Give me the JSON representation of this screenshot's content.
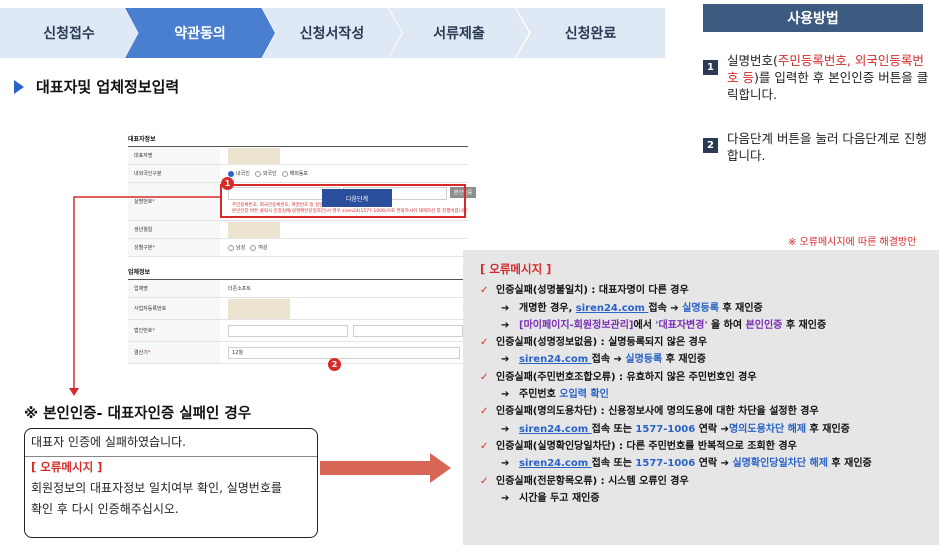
{
  "steps": [
    "신청접수",
    "약관동의",
    "신청서작성",
    "서류제출",
    "신청완료"
  ],
  "section_title": "대표자및 업체정보입력",
  "usage": {
    "title": "사용방법",
    "items": [
      {
        "num": "1",
        "pre": "실명번호(",
        "red": "주민등록번호, 외국인등록번호 등",
        "post": ")를 입력한 후 본인인증 버튼을 클릭합니다."
      },
      {
        "num": "2",
        "text": "다음단계 버튼을 눌러 다음단계로 진행합니다."
      }
    ]
  },
  "form": {
    "rep_header": "대표자정보",
    "rows": {
      "name": "대표자명",
      "nationality": "내외국인구분",
      "nat_opts": [
        "내국인",
        "외국인",
        "해외동포"
      ],
      "idnum": "실명번호",
      "auth_btn": "본인인증",
      "note1": "주민등록번호, 외국인등록번호, 여권번호 등 실명번호 입력",
      "note2": "본인인증 버튼 클릭시 인증실패(실명확인당일차단)시 경우 siren24(1577-1006)으로 연락하시어 해제하신 후 진행바랍니다.",
      "birth": "생년월일",
      "gender": "성별구분",
      "gender_opts": [
        "남성",
        "여성"
      ]
    },
    "biz_header": "업체정보",
    "biz_rows": {
      "company": "업체명",
      "company_val": "더존소프트",
      "bizno": "사업자등록번호",
      "corpno": "법인번호",
      "closing": "결산기",
      "closing_val": "12월"
    },
    "next_btn": "다음단계",
    "badge1": "1",
    "badge2": "2"
  },
  "fail_title": "※ 본인인증- 대표자인증 실패인 경우",
  "msgbox": {
    "line1": "대표자 인증에 실패하였습니다.",
    "label": "[ 오류메시지 ]",
    "line2": "회원정보의 대표자정보 일치여부 확인, 실명번호를",
    "line3": "확인 후 다시 인증해주십시오."
  },
  "err_link": "※ 오류메시지에 따른 해결방안",
  "errpanel": {
    "title": "[ 오류메시지 ]",
    "e1": {
      "head": "인증실패(성명불일치) : 대표자명이 다른 경우",
      "s1a": "개명한 경우, ",
      "s1b": "siren24.com ",
      "s1c": "접속 ➔ ",
      "s1d": "실명등록",
      "s1e": " 후 재인증",
      "s2a": "[마이페이지-회원정보관리]",
      "s2b": "에서 ",
      "s2c": "'대표자변경'",
      "s2d": " 을 하여 ",
      "s2e": "본인인증",
      "s2f": " 후 재인증"
    },
    "e2": {
      "head": "인증실패(성명정보없음) : 실명등록되지 않은 경우",
      "sa": "siren24.com ",
      "sb": "접속 ➔ ",
      "sc": "실명등록",
      "sd": " 후 재인증"
    },
    "e3": {
      "head": "인증실패(주민번호조합오류) : 유효하지 않은 주민번호인 경우",
      "sa": "주민번호 ",
      "sb": "오입력 확인"
    },
    "e4": {
      "head": "인증실패(명의도용차단) :  신용정보사에 명의도용에 대한 차단을 설정한 경우",
      "sa": "siren24.com ",
      "sb": "접속 또는 ",
      "sc": "1577-1006",
      "sd": " 연락 ➔",
      "se": "명의도용차단 해제",
      "sf": " 후 재인증"
    },
    "e5": {
      "head": "인증실패(실명확인당일차단) : 다른 주민번호를 반복적으로 조회한 경우",
      "sa": "siren24.com ",
      "sb": "접속 또는 ",
      "sc": "1577-1006",
      "sd": " 연락 ➔ ",
      "se": "실명확인당일차단 해제",
      "sf": " 후 재인증"
    },
    "e6": {
      "head": "인증실패(전문항목오류) : 시스템 오류인 경우",
      "sa": "시간을 두고 재인증"
    }
  }
}
